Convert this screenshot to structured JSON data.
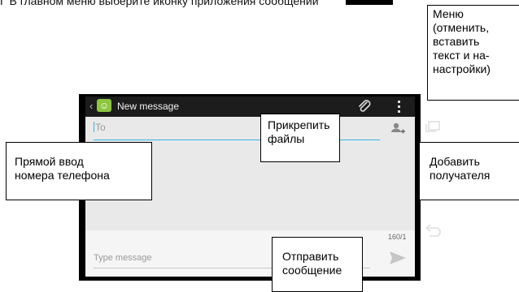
{
  "instruction": "Г В главном меню выберите иконку приложения сообщений",
  "app": {
    "title": "New message",
    "to_placeholder": "To",
    "message_placeholder": "Type message",
    "counter": "160/1",
    "icons": {
      "app": "messaging-app-icon",
      "attach": "paperclip-icon",
      "menu": "overflow-menu-icon",
      "add_recipient": "add-person-icon",
      "send": "send-icon",
      "recent_apps": "recent-apps-icon",
      "back": "back-icon"
    },
    "colors": {
      "accent": "#33b5e5",
      "app_icon": "#8cc63f",
      "action_bar": "#1c1c1c"
    }
  },
  "callouts": {
    "menu": "Меню\n(отменить,\nвставить\nтекст и на-\nнастройки)",
    "attach": "Прикрепить\nфайлы",
    "direct_input": "Прямой ввод\nномера телефона",
    "add_recipient": "Добавить\nполучателя",
    "send": "Отправить\nсообщение"
  }
}
